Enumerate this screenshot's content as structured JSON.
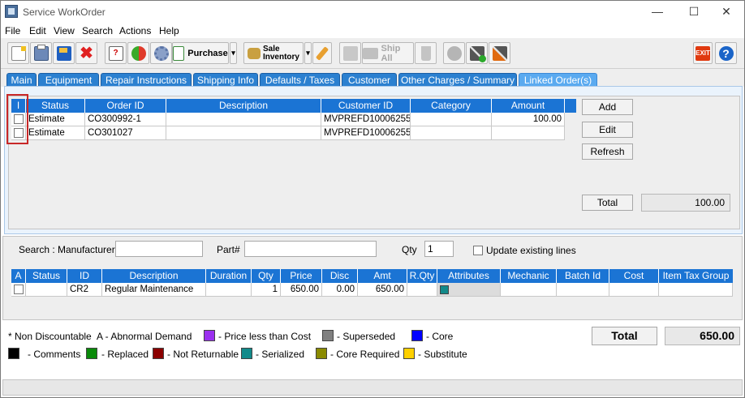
{
  "window": {
    "title": "Service WorkOrder",
    "controls": [
      "—",
      "☐",
      "✕"
    ]
  },
  "menu": [
    "File",
    "Edit",
    "View",
    "Search",
    "Actions",
    "Help"
  ],
  "toolbar": {
    "purchase_label": "Purchase",
    "sale_inventory_line1": "Sale",
    "sale_inventory_line2": "Inventory",
    "ship_all_label": "Ship All"
  },
  "tabs": [
    "Main",
    "Equipment",
    "Repair Instructions",
    "Shipping Info",
    "Defaults / Taxes",
    "Customer",
    "Other Charges / Summary",
    "Linked Order(s)"
  ],
  "linked_orders": {
    "columns": [
      "I",
      "Status",
      "Order ID",
      "Description",
      "Customer ID",
      "Category",
      "Amount"
    ],
    "rows": [
      {
        "status": "Estimate",
        "order_id": "CO300992-1",
        "description": "",
        "customer_id": "MVPREFD10006255",
        "category": "",
        "amount": "100.00"
      },
      {
        "status": "Estimate",
        "order_id": "CO301027",
        "description": "",
        "customer_id": "MVPREFD10006255",
        "category": "",
        "amount": ""
      }
    ],
    "buttons": {
      "add": "Add",
      "edit": "Edit",
      "refresh": "Refresh"
    },
    "total_label": "Total",
    "total_value": "100.00"
  },
  "search": {
    "label": "Search :",
    "manufacturer_label": "Manufacturer",
    "manufacturer_value": "",
    "part_label": "Part#",
    "part_value": "",
    "qty_label": "Qty",
    "qty_value": "1",
    "update_label": "Update existing lines"
  },
  "lines": {
    "columns": [
      "A",
      "Status",
      "ID",
      "Description",
      "Duration",
      "Qty",
      "Price",
      "Disc",
      "Amt",
      "R.Qty",
      "Attributes",
      "Mechanic",
      "Batch Id",
      "Cost",
      "Item Tax Group"
    ],
    "rows": [
      {
        "status": "",
        "id": "CR2",
        "description": "Regular Maintenance",
        "duration": "",
        "qty": "1",
        "price": "650.00",
        "disc": "0.00",
        "amt": "650.00",
        "rqty": "",
        "attribute_color": "#138a8a",
        "mechanic": "",
        "batch_id": "",
        "cost": "",
        "item_tax_group": ""
      }
    ]
  },
  "legend": {
    "non_discountable": "* Non Discountable",
    "abnormal_demand": "A - Abnormal Demand",
    "items_row1": [
      {
        "color": "#9b30f0",
        "label": "- Price less than Cost"
      },
      {
        "color": "#808080",
        "label": "- Superseded"
      },
      {
        "color": "#0000ff",
        "label": "- Core"
      }
    ],
    "items_row2": [
      {
        "color": "#000000",
        "label": "- Comments"
      },
      {
        "color": "#0a8a0a",
        "label": "- Replaced"
      },
      {
        "color": "#8b0000",
        "label": "- Not Returnable"
      },
      {
        "color": "#138a8a",
        "label": "- Serialized"
      },
      {
        "color": "#8a8a00",
        "label": "- Core Required"
      },
      {
        "color": "#ffd000",
        "label": "- Substitute"
      }
    ]
  },
  "grand_total": {
    "label": "Total",
    "value": "650.00"
  },
  "icons": [
    "app-icon",
    "new-icon",
    "print-icon",
    "save-icon",
    "delete-icon",
    "help-book-icon",
    "refresh-icon",
    "settings-icon",
    "purchase-icon",
    "sale-inventory-icon",
    "edit-pencil-icon",
    "ship-all-icon",
    "trash-icon",
    "tools-add-icon",
    "tools-icon",
    "exit-icon",
    "help-icon"
  ]
}
